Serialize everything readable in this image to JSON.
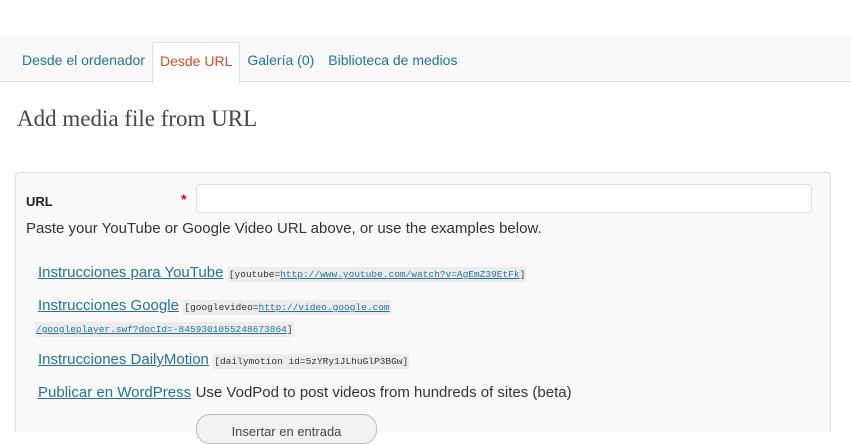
{
  "tabs": [
    {
      "label": "Desde el ordenador",
      "active": false
    },
    {
      "label": "Desde URL",
      "active": true
    },
    {
      "label": "Galería (0)",
      "active": false
    },
    {
      "label": "Biblioteca de medios",
      "active": false
    }
  ],
  "heading": "Add media file from URL",
  "form": {
    "url_label": "URL",
    "required_marker": "*",
    "url_value": "",
    "help_text": "Paste your YouTube or Google Video URL above, or use the examples below."
  },
  "instructions": {
    "youtube": {
      "link": "Instrucciones para YouTube",
      "code_prefix": "[youtube=",
      "code_link": "http://www.youtube.com/watch?v=AgEmZ39EtFk",
      "code_suffix": "]"
    },
    "google": {
      "link": "Instrucciones Google",
      "code_prefix": "[googlevideo=",
      "code_link_1": "http://video.google.com",
      "code_link_2": "/googleplayer.swf?docId=-8459301055248673864",
      "code_suffix": "]"
    },
    "dailymotion": {
      "link": "Instrucciones DailyMotion",
      "code": "[dailymotion id=5zYRy1JLhuGlP3BGw]"
    },
    "wordpress": {
      "link": "Publicar en WordPress",
      "text": "Use VodPod to post videos from hundreds of sites (beta)"
    }
  },
  "buttons": {
    "insert_label": "Insertar en entrada"
  },
  "colors": {
    "link": "#21759b",
    "active_tab": "#d54e21",
    "required": "#ff0000",
    "panel_bg": "#f9f9f9",
    "border": "#dfdfdf"
  }
}
